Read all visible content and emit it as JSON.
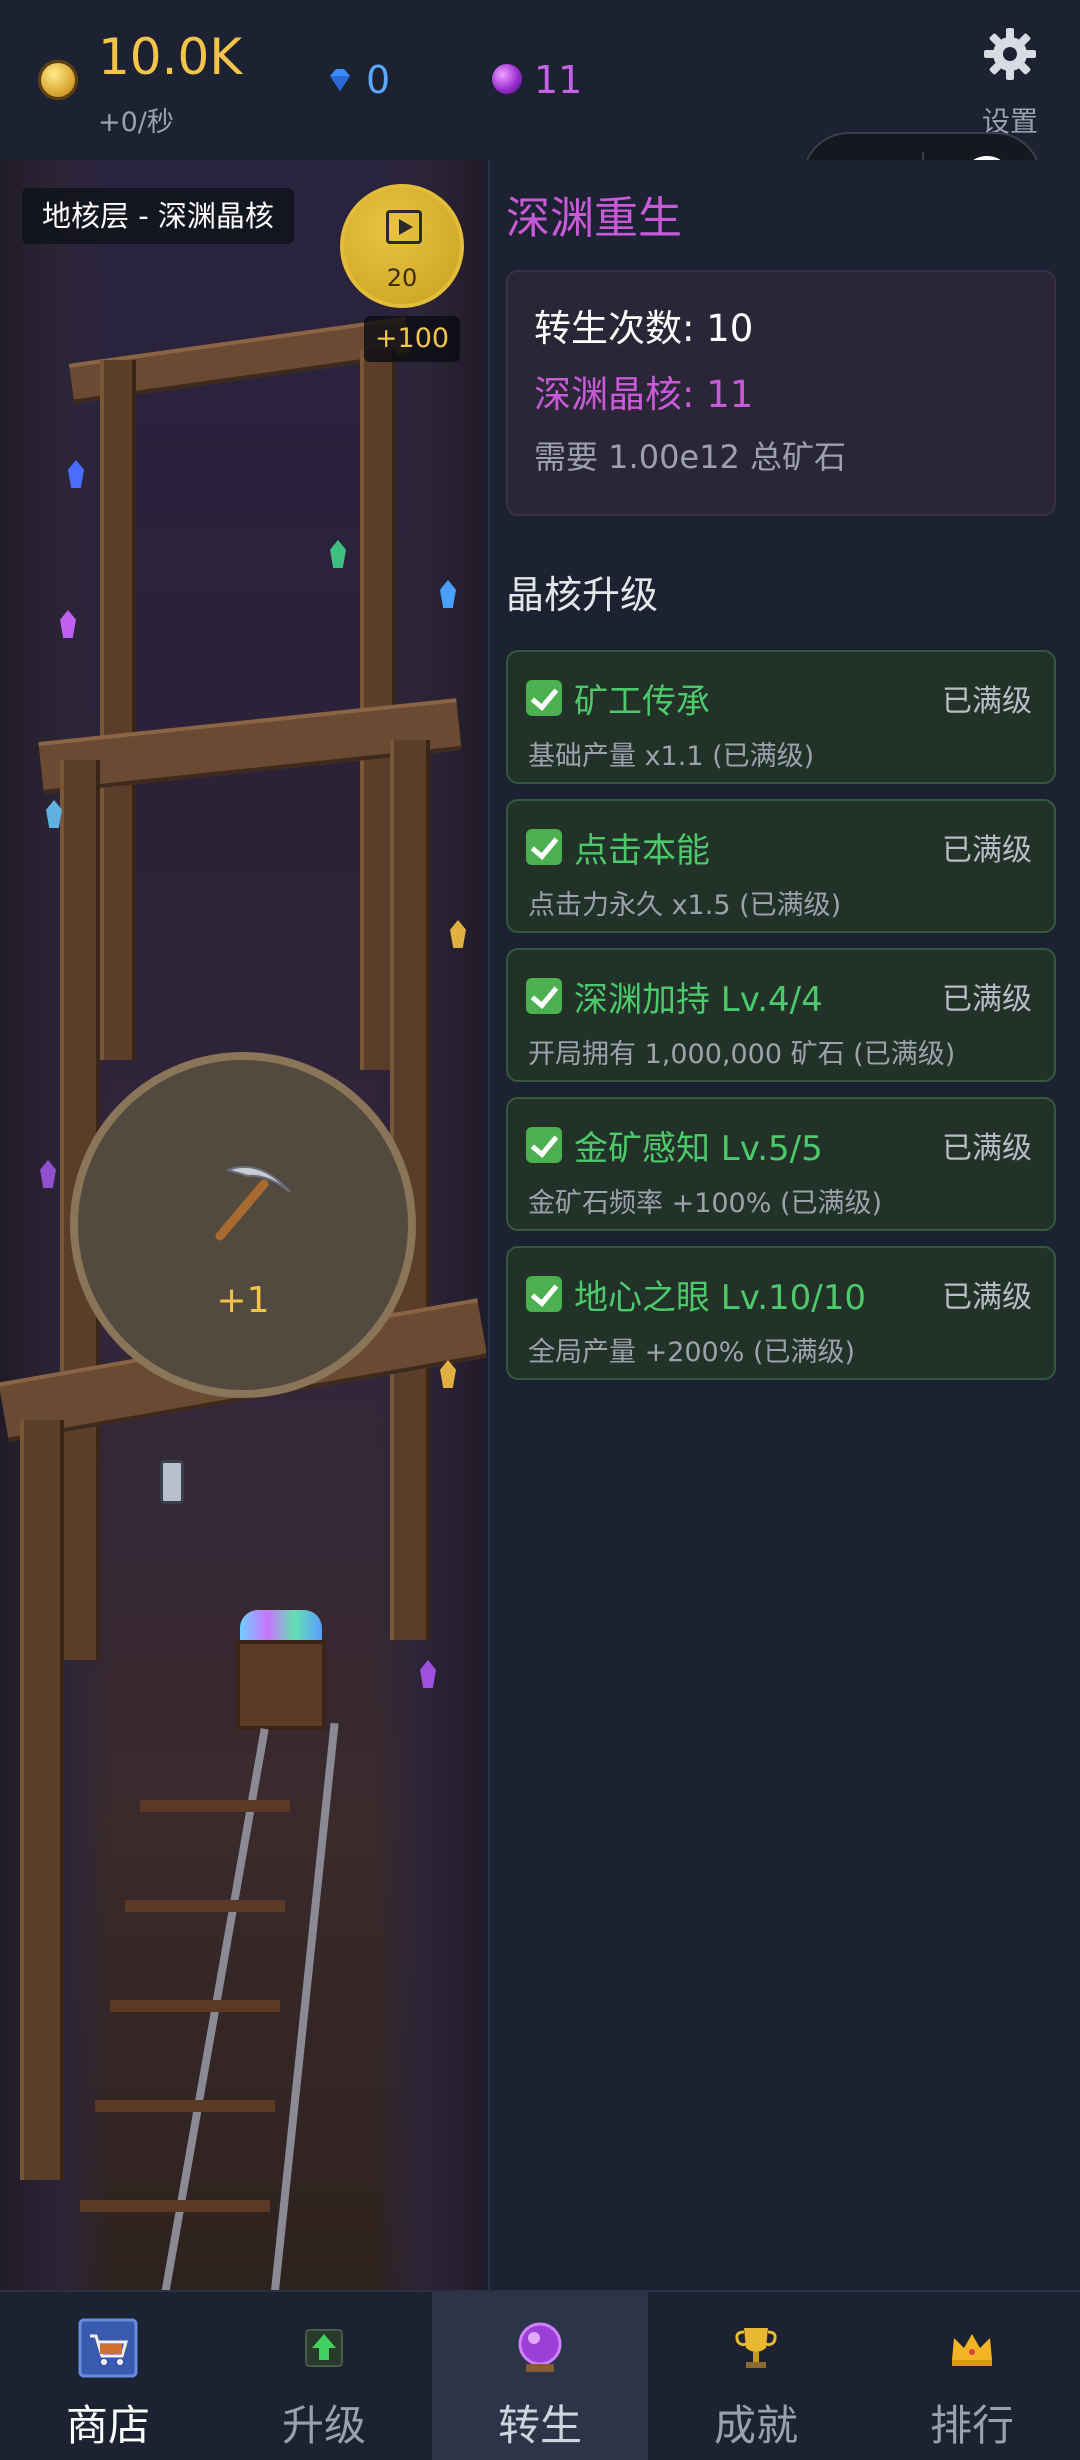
{
  "header": {
    "gold": "10.0K",
    "gold_rate": "+0/秒",
    "diamonds": "0",
    "crystals": "11",
    "settings_label": "设置"
  },
  "mine": {
    "level_label": "地核层 - 深渊晶核",
    "video_count": "20",
    "video_bonus": "+100",
    "tap_value": "+1"
  },
  "rebirth": {
    "title": "深渊重生",
    "count_text": "转生次数: 10",
    "core_text": "深渊晶核: 11",
    "requirement": "需要 1.00e12 总矿石"
  },
  "upgrades_title": "晶核升级",
  "upgrades": [
    {
      "name": "矿工传承",
      "status": "已满级",
      "desc": "基础产量 x1.1 (已满级)"
    },
    {
      "name": "点击本能",
      "status": "已满级",
      "desc": "点击力永久 x1.5 (已满级)"
    },
    {
      "name": "深渊加持 Lv.4/4",
      "status": "已满级",
      "desc": "开局拥有 1,000,000 矿石 (已满级)"
    },
    {
      "name": "金矿感知 Lv.5/5",
      "status": "已满级",
      "desc": "金矿石频率 +100% (已满级)"
    },
    {
      "name": "地心之眼 Lv.10/10",
      "status": "已满级",
      "desc": "全局产量 +200% (已满级)"
    }
  ],
  "nav": [
    {
      "label": "商店",
      "icon": "shop-cart-icon"
    },
    {
      "label": "升级",
      "icon": "upgrade-arrow-icon"
    },
    {
      "label": "转生",
      "icon": "crystal-ball-icon"
    },
    {
      "label": "成就",
      "icon": "trophy-icon"
    },
    {
      "label": "排行",
      "icon": "crown-icon"
    }
  ],
  "colors": {
    "gold": "#f3c34a",
    "diamond": "#5aa8ff",
    "crystal": "#c860e8",
    "upgrade_green": "#4cc96a",
    "background": "#1c2232"
  }
}
